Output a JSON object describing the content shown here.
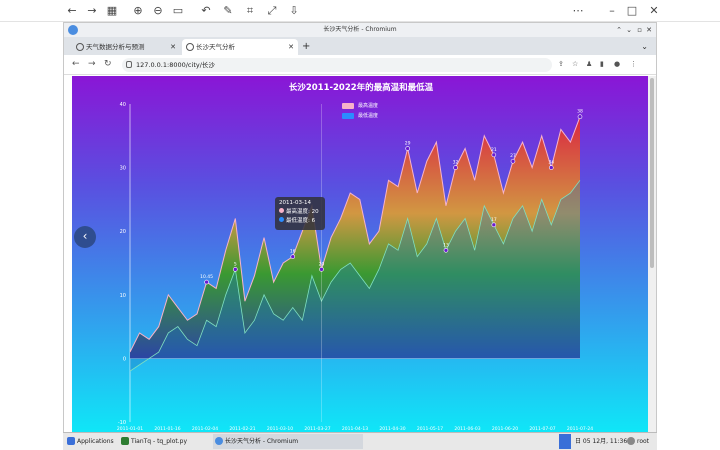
{
  "window": {
    "title": "长沙天气分析 - Chromium"
  },
  "tabs": [
    {
      "label": "天气数据分析与预测"
    },
    {
      "label": "长沙天气分析"
    }
  ],
  "address": {
    "url": "127.0.0.1:8000/city/长沙"
  },
  "taskbar": {
    "apps_label": "Applications",
    "items": [
      {
        "label": "TianTq - tq_plot.py"
      },
      {
        "label": "长沙天气分析 - Chromium"
      }
    ],
    "clock": "日 05 12月, 11:36",
    "user": "root"
  },
  "tooltip": {
    "date": "2011-03-14",
    "high_label": "最高温度: 20",
    "low_label": "最低温度: 6"
  },
  "colors": {
    "high_series": "#f7b3c9",
    "low_series": "#2b8cff"
  },
  "chart_data": {
    "type": "area",
    "title": "长沙2011-2022年的最高温和最低温",
    "series": [
      {
        "name": "最高温度"
      },
      {
        "name": "最低温度"
      }
    ],
    "ylim": [
      -10,
      40
    ],
    "yticks": [
      "-10",
      "0",
      "10",
      "20",
      "30",
      "40"
    ],
    "x": [
      "2011-01-01",
      "2011-01-16",
      "2011-02-04",
      "2011-02-21",
      "2011-03-10",
      "2011-03-27",
      "2011-04-13",
      "2011-04-30",
      "2011-05-17",
      "2011-06-03",
      "2011-06-20",
      "2011-07-07",
      "2011-07-24"
    ],
    "high": [
      1,
      4,
      3,
      5,
      10,
      8,
      6,
      7,
      12,
      11,
      17,
      22,
      9,
      13,
      19,
      12,
      15,
      16,
      20,
      24,
      14,
      19,
      22,
      26,
      25,
      18,
      20,
      28,
      27,
      33,
      26,
      31,
      34,
      24,
      30,
      33,
      28,
      35,
      32,
      26,
      31,
      34,
      30,
      35,
      30,
      36,
      34,
      38
    ],
    "low": [
      -2,
      -1,
      0,
      1,
      4,
      5,
      3,
      2,
      6,
      5,
      10,
      14,
      4,
      6,
      10,
      7,
      6,
      8,
      6,
      13,
      9,
      12,
      14,
      15,
      13,
      11,
      14,
      18,
      17,
      22,
      16,
      18,
      22,
      17,
      20,
      22,
      17,
      24,
      21,
      18,
      22,
      24,
      20,
      25,
      21,
      25,
      26,
      28
    ],
    "data_labels": [
      {
        "x_index": 8,
        "series": "high",
        "text": "10.45"
      },
      {
        "x_index": 17,
        "series": "high",
        "text": "16"
      },
      {
        "x_index": 20,
        "series": "high",
        "text": "20"
      },
      {
        "x_index": 29,
        "series": "high",
        "text": "29"
      },
      {
        "x_index": 34,
        "series": "high",
        "text": "32"
      },
      {
        "x_index": 38,
        "series": "high",
        "text": "21"
      },
      {
        "x_index": 40,
        "series": "high",
        "text": "27"
      },
      {
        "x_index": 44,
        "series": "high",
        "text": "34"
      },
      {
        "x_index": 47,
        "series": "high",
        "text": "38"
      },
      {
        "x_index": 11,
        "series": "low",
        "text": "5"
      },
      {
        "x_index": 33,
        "series": "low",
        "text": "13"
      },
      {
        "x_index": 38,
        "series": "low",
        "text": "17"
      }
    ]
  }
}
